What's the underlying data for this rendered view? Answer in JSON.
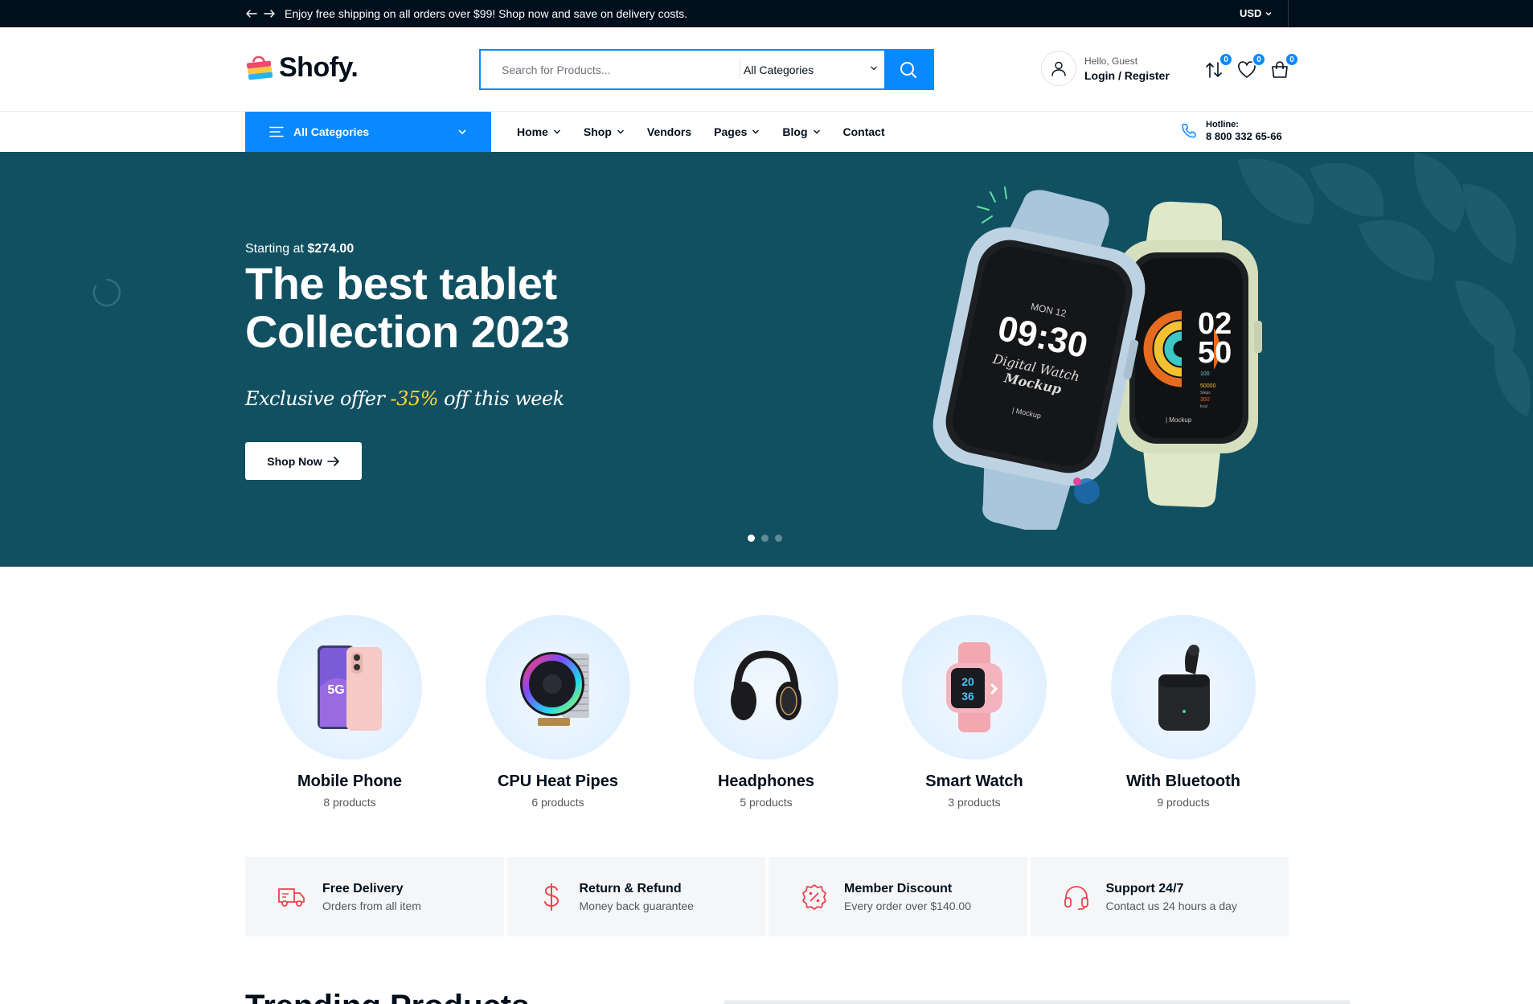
{
  "topbar": {
    "notice": "Enjoy free shipping on all orders over $99! Shop now and save on delivery costs.",
    "currency": "USD",
    "prev_icon": "arrow-left-icon",
    "next_icon": "arrow-right-icon"
  },
  "header": {
    "logo_text": "Shofy.",
    "search": {
      "placeholder": "Search for Products...",
      "value": "",
      "category": "All Categories"
    },
    "account": {
      "greeting": "Hello, Guest",
      "login_label": "Login / Register"
    },
    "badges": {
      "compare": "0",
      "wishlist": "0",
      "cart": "0"
    }
  },
  "nav": {
    "all_categories": "All Categories",
    "items": [
      {
        "label": "Home",
        "dropdown": true
      },
      {
        "label": "Shop",
        "dropdown": true
      },
      {
        "label": "Vendors",
        "dropdown": false
      },
      {
        "label": "Pages",
        "dropdown": true
      },
      {
        "label": "Blog",
        "dropdown": true
      },
      {
        "label": "Contact",
        "dropdown": false
      }
    ],
    "hotline_label": "Hotline:",
    "hotline_number": "8 800 332 65-66"
  },
  "hero": {
    "starting_prefix": "Starting at",
    "starting_price": "$274.00",
    "title": "The best tablet Collection 2023",
    "offer_prefix": "Exclusive offer",
    "offer_pct": "-35%",
    "offer_suffix": "off this week",
    "cta": "Shop Now",
    "watch1_day": "MON 12",
    "watch1_time": "09:30",
    "watch1_caption_1": "Digital Watch",
    "watch1_caption_2": "Mockup",
    "watch1_brand": "| Mockup",
    "watch2_hour": "02",
    "watch2_min": "50",
    "watch2_brand": "| Mockup",
    "watch2_stats": [
      "100",
      "50000",
      "Steps",
      "350",
      "kcal"
    ],
    "slides": 3,
    "active_slide": 0,
    "bg_color": "#115061"
  },
  "categories": [
    {
      "name": "Mobile Phone",
      "count": "8 products",
      "icon": "mobile-phone-icon"
    },
    {
      "name": "CPU Heat Pipes",
      "count": "6 products",
      "icon": "cpu-cooler-icon"
    },
    {
      "name": "Headphones",
      "count": "5 products",
      "icon": "headphones-icon"
    },
    {
      "name": "Smart Watch",
      "count": "3 products",
      "icon": "smart-watch-icon"
    },
    {
      "name": "With Bluetooth",
      "count": "9 products",
      "icon": "earbuds-icon"
    }
  ],
  "features": [
    {
      "title": "Free Delivery",
      "sub": "Orders from all item",
      "icon": "delivery-truck-icon"
    },
    {
      "title": "Return & Refund",
      "sub": "Money back guarantee",
      "icon": "dollar-icon"
    },
    {
      "title": "Member Discount",
      "sub": "Every order over $140.00",
      "icon": "discount-badge-icon"
    },
    {
      "title": "Support 24/7",
      "sub": "Contact us 24 hours a day",
      "icon": "headset-icon"
    }
  ],
  "section_heading": "Trending Products",
  "colors": {
    "accent": "#0989ff",
    "dark": "#010f1c",
    "feature_icon": "#f0424b",
    "offer_highlight": "#ffd43a"
  }
}
